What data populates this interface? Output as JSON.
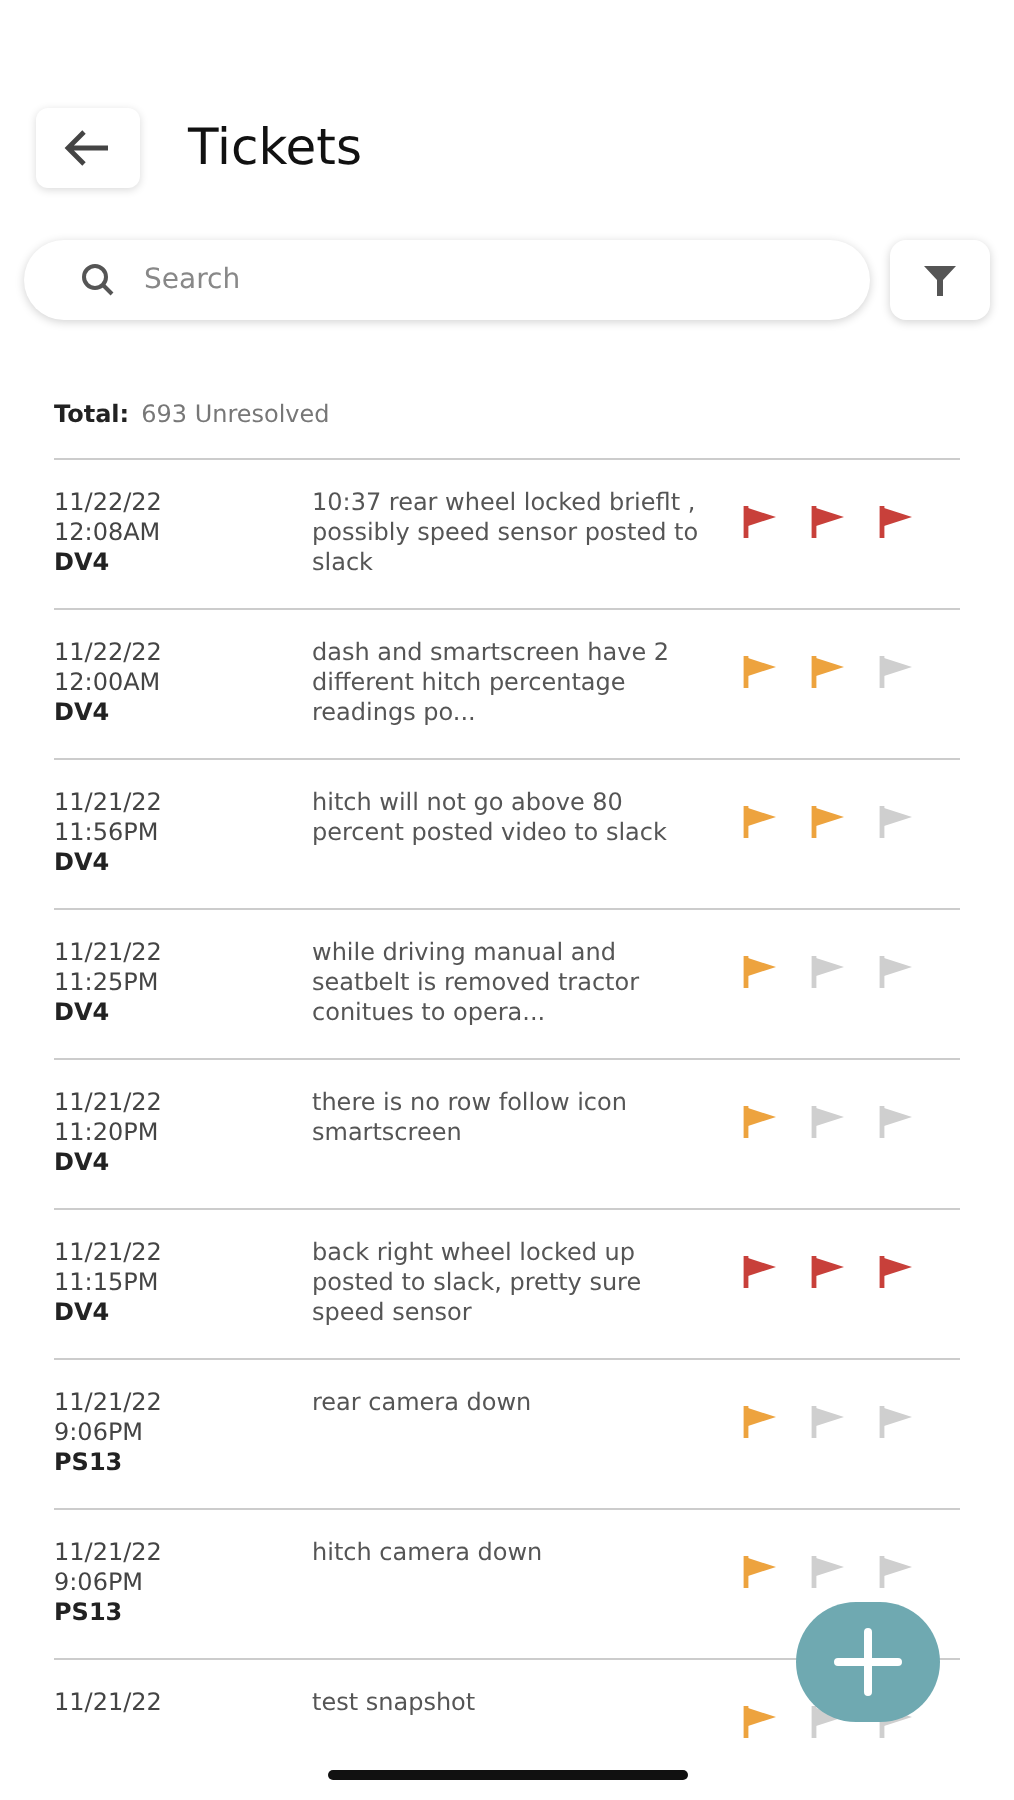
{
  "header": {
    "title": "Tickets"
  },
  "search": {
    "placeholder": "Search"
  },
  "summary": {
    "label": "Total:",
    "value": "693 Unresolved"
  },
  "tickets": [
    {
      "date": "11/22/22",
      "time": "12:08AM",
      "unit": "DV4",
      "description": "10:37 rear wheel locked brieflt , possibly speed sensor posted to slack",
      "color": "#c8403a",
      "flags": [
        {
          "on": true
        },
        {
          "on": true
        },
        {
          "on": true
        }
      ]
    },
    {
      "date": "11/22/22",
      "time": "12:00AM",
      "unit": "DV4",
      "description": "dash and smartscreen have 2 different hitch percentage readings po...",
      "color": "#eda33e",
      "flags": [
        {
          "on": true
        },
        {
          "on": true
        },
        {
          "on": false
        }
      ]
    },
    {
      "date": "11/21/22",
      "time": "11:56PM",
      "unit": "DV4",
      "description": "hitch will not go above 80 percent posted video to slack",
      "color": "#eda33e",
      "flags": [
        {
          "on": true
        },
        {
          "on": true
        },
        {
          "on": false
        }
      ]
    },
    {
      "date": "11/21/22",
      "time": "11:25PM",
      "unit": "DV4",
      "description": "while driving manual and seatbelt is removed tractor conitues to opera...",
      "color": "#eda33e",
      "flags": [
        {
          "on": true
        },
        {
          "on": false
        },
        {
          "on": false
        }
      ]
    },
    {
      "date": "11/21/22",
      "time": "11:20PM",
      "unit": "DV4",
      "description": "there is no row follow icon smartscreen",
      "color": "#eda33e",
      "flags": [
        {
          "on": true
        },
        {
          "on": false
        },
        {
          "on": false
        }
      ]
    },
    {
      "date": "11/21/22",
      "time": "11:15PM",
      "unit": "DV4",
      "description": "back right wheel locked up posted to slack, pretty sure speed sensor",
      "color": "#c8403a",
      "flags": [
        {
          "on": true
        },
        {
          "on": true
        },
        {
          "on": true
        }
      ]
    },
    {
      "date": "11/21/22",
      "time": "9:06PM",
      "unit": "PS13",
      "description": "rear camera down",
      "color": "#eda33e",
      "flags": [
        {
          "on": true
        },
        {
          "on": false
        },
        {
          "on": false
        }
      ]
    },
    {
      "date": "11/21/22",
      "time": "9:06PM",
      "unit": "PS13",
      "description": "hitch camera down",
      "color": "#eda33e",
      "flags": [
        {
          "on": true
        },
        {
          "on": false
        },
        {
          "on": false
        }
      ]
    },
    {
      "date": "11/21/22",
      "description": "test snapshot",
      "color": "#eda33e",
      "flags": [
        {
          "on": true
        },
        {
          "on": false
        },
        {
          "on": false
        }
      ]
    }
  ]
}
